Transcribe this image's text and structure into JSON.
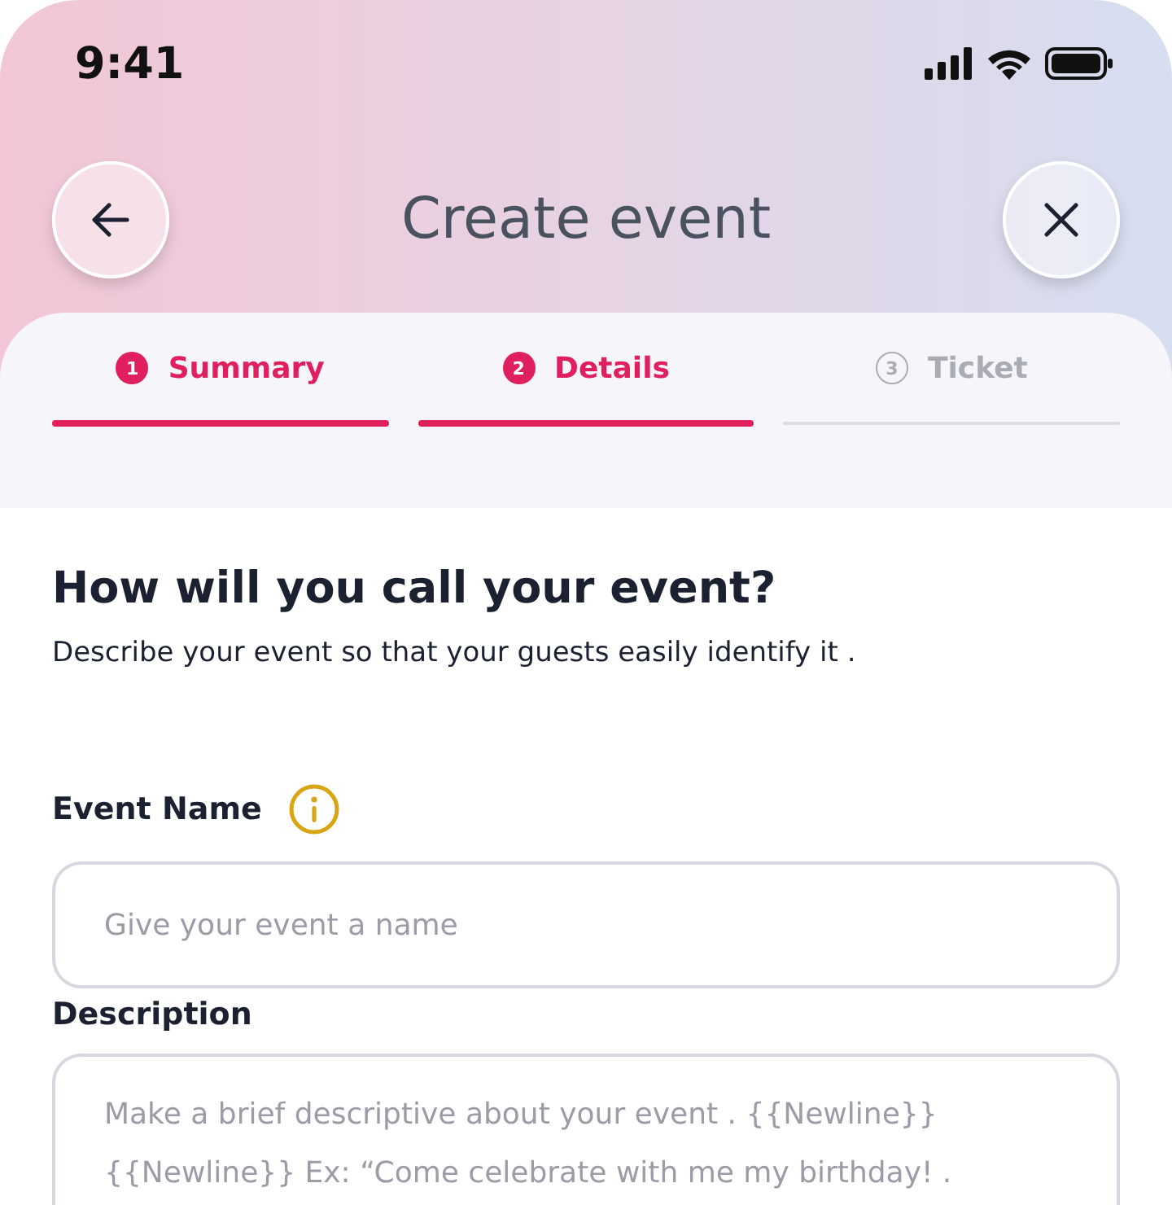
{
  "status_bar": {
    "time": "9:41"
  },
  "header": {
    "title": "Create event"
  },
  "steps": [
    {
      "number": "1",
      "label": "Summary",
      "active": true
    },
    {
      "number": "2",
      "label": "Details",
      "active": true
    },
    {
      "number": "3",
      "label": "Ticket",
      "active": false
    }
  ],
  "section": {
    "heading": "How will you call your event?",
    "subtitle": "Describe your event so that your guests easily identify it ."
  },
  "fields": [
    {
      "kind": "input",
      "label": "Event Name",
      "info": true,
      "placeholder": "Give your event a name"
    },
    {
      "kind": "textarea",
      "label": "Description",
      "info": false,
      "placeholder": "Make a brief descriptive about your event . {{Newline}} {{Newline}} Ex: “Come celebrate with me my birthday! ."
    }
  ]
}
